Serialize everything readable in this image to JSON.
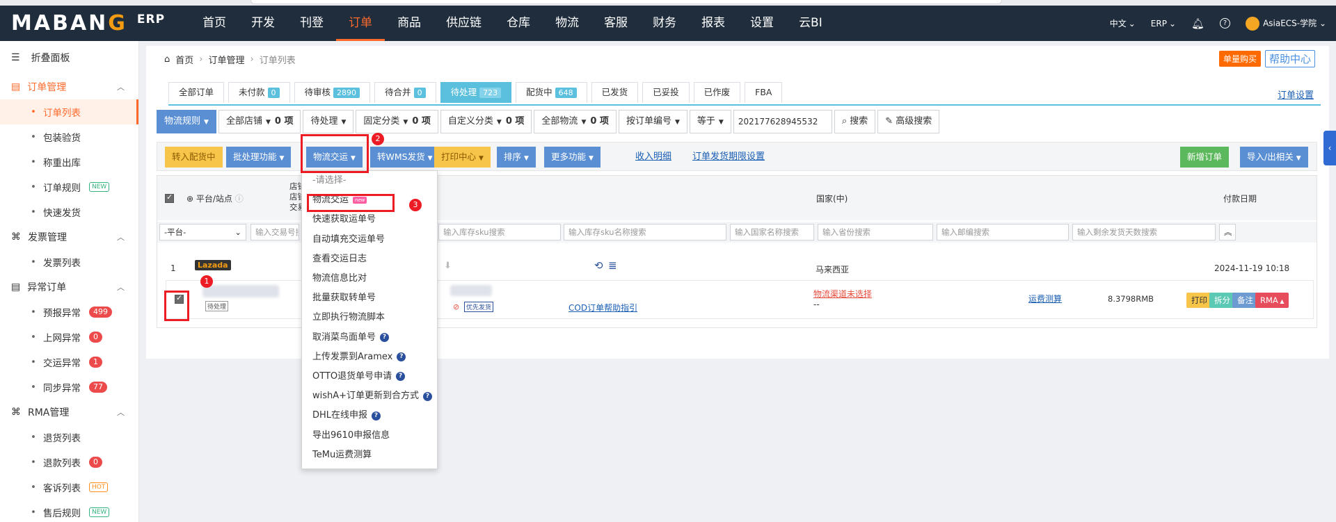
{
  "logo": {
    "text_a": "MABAN",
    "text_b": "G",
    "text_c": "",
    "suffix": "ERP"
  },
  "nav": {
    "items": [
      "首页",
      "开发",
      "刊登",
      "订单",
      "商品",
      "供应链",
      "仓库",
      "物流",
      "客服",
      "财务",
      "报表",
      "设置",
      "云BI"
    ],
    "active": "订单",
    "lang": "中文",
    "erp": "ERP",
    "user": "AsiaECS-学院"
  },
  "sidebar": {
    "collapse": "折叠面板",
    "order_group": "订单管理",
    "order_items": [
      {
        "label": "订单列表"
      },
      {
        "label": "包装验货"
      },
      {
        "label": "称重出库"
      },
      {
        "label": "订单规则",
        "tag": "NEW"
      },
      {
        "label": "快速发货"
      }
    ],
    "invoice_group": "发票管理",
    "invoice_items": [
      {
        "label": "发票列表"
      }
    ],
    "abnormal_group": "异常订单",
    "abnormal_items": [
      {
        "label": "预报异常",
        "count": "499"
      },
      {
        "label": "上网异常",
        "count": "0"
      },
      {
        "label": "交运异常",
        "count": "1"
      },
      {
        "label": "同步异常",
        "count": "77"
      }
    ],
    "rma_group": "RMA管理",
    "rma_items": [
      {
        "label": "退货列表"
      },
      {
        "label": "退款列表",
        "count": "0"
      },
      {
        "label": "客诉列表",
        "tag": "HOT"
      },
      {
        "label": "售后规则",
        "tag": "NEW"
      }
    ]
  },
  "breadcrumb": {
    "home": "首页",
    "section": "订单管理",
    "current": "订单列表"
  },
  "top_buttons": {
    "buy": "单量购买",
    "help": "帮助中心"
  },
  "tabs": [
    {
      "label": "全部订单"
    },
    {
      "label": "未付款",
      "count": "0"
    },
    {
      "label": "待审核",
      "count": "2890"
    },
    {
      "label": "待合并",
      "count": "0"
    },
    {
      "label": "待处理",
      "count": "723"
    },
    {
      "label": "配货中",
      "count": "648"
    },
    {
      "label": "已发货"
    },
    {
      "label": "已妥投"
    },
    {
      "label": "已作废"
    },
    {
      "label": "FBA"
    }
  ],
  "order_settings": "订单设置",
  "filters": {
    "logistics_rule": "物流规则",
    "all_shops": "全部店铺",
    "all_shops_count": "0 项",
    "pending": "待处理",
    "fixed_class": "固定分类",
    "fixed_count": "0 项",
    "custom_class": "自定义分类",
    "custom_count": "0 项",
    "all_logistics": "全部物流",
    "logistics_count": "0 项",
    "by_order_no": "按订单编号",
    "equals": "等于",
    "search_value": "202177628945532",
    "search": "搜索",
    "advanced": "高级搜索"
  },
  "actions": {
    "assign_stock": "转入配货中",
    "batch": "批处理功能",
    "logistics_ship": "物流交运",
    "wms": "转WMS发货",
    "print": "打印中心",
    "sort": "排序",
    "more": "更多功能",
    "receipt": "收入明细",
    "deadline": "订单发货期限设置",
    "new_order": "新增订单",
    "import_export": "导入/出相关"
  },
  "table": {
    "platform_col": "平台/站点",
    "shop_col_lines": [
      "店铺",
      "店铺",
      "交易"
    ],
    "country_col": "国家(中)",
    "pay_date_col": "付款日期",
    "filter_platform": "-平台-",
    "placeholders": {
      "trade_no": "输入交易号搜索",
      "sku": "输入库存sku搜索",
      "sku_name": "输入库存sku名称搜索",
      "country": "输入国家名称搜索",
      "province": "输入省份搜索",
      "zip": "输入邮编搜索",
      "days": "输入剩余发货天数搜索"
    },
    "group_index": "1",
    "group_platform": "Lazada",
    "group_country": "马来西亚",
    "group_date": "2024-11-19 10:18",
    "row": {
      "pending_tag": "待处理",
      "priority": "优先发货",
      "cod_link": "COD订单帮助指引",
      "channel_unselected": "物流渠道未选择",
      "dash": "--",
      "freight": "运费测算",
      "amount": "8.3798RMB",
      "print": "打印",
      "split": "拆分",
      "note": "备注",
      "rma": "RMA"
    }
  },
  "dropdown": {
    "placeholder": "-请选择-",
    "items": [
      {
        "label": "物流交运",
        "new": "new"
      },
      {
        "label": "快速获取运单号"
      },
      {
        "label": "自动填充交运单号"
      },
      {
        "label": "查看交运日志"
      },
      {
        "label": "物流信息比对"
      },
      {
        "label": "批量获取转单号"
      },
      {
        "label": "立即执行物流脚本"
      },
      {
        "label": "取消菜鸟面单号",
        "help": true
      },
      {
        "label": "上传发票到Aramex",
        "help": true
      },
      {
        "label": "OTTO退货单号申请",
        "help": true
      },
      {
        "label": "wishA+订单更新到合方式",
        "help": true
      },
      {
        "label": "DHL在线申报",
        "help": true
      },
      {
        "label": "导出9610申报信息"
      },
      {
        "label": "TeMu运费测算"
      }
    ]
  },
  "steps": [
    "1",
    "2",
    "3"
  ],
  "colors": {
    "nav_bg": "#1f2d3d",
    "accent": "#ff6a2a",
    "tab_active": "#5bc0de",
    "btn_blue": "#5b8fd4",
    "annotation": "#ed1c24"
  }
}
